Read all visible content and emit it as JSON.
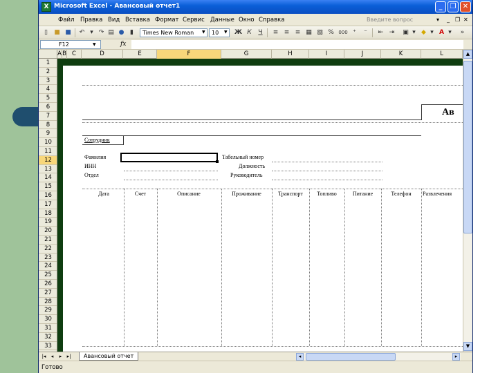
{
  "window": {
    "title": "Microsoft Excel - Авансовый отчет1",
    "icon_label": "X",
    "minimize": "_",
    "restore": "❐",
    "close": "✕"
  },
  "menu": {
    "items": [
      "Файл",
      "Правка",
      "Вид",
      "Вставка",
      "Формат",
      "Сервис",
      "Данные",
      "Окно",
      "Справка"
    ],
    "help_placeholder": "Введите вопрос",
    "doc_minimize": "_",
    "doc_restore": "❐",
    "doc_close": "✕"
  },
  "toolbar": {
    "font_name": "Times New Roman",
    "font_size": "10",
    "bold": "Ж",
    "italic": "К",
    "underline": "Ч",
    "percent": "%",
    "thousands": "000"
  },
  "formula_bar": {
    "name_box": "F12",
    "fx": "fx"
  },
  "columns": [
    "A",
    "B",
    "C",
    "D",
    "E",
    "F",
    "G",
    "H",
    "I",
    "J",
    "K",
    "L"
  ],
  "rows": [
    "1",
    "2",
    "3",
    "4",
    "5",
    "6",
    "7",
    "8",
    "9",
    "10",
    "11",
    "12",
    "13",
    "14",
    "15",
    "16",
    "17",
    "18",
    "19",
    "20",
    "21",
    "22",
    "23",
    "24",
    "25",
    "26",
    "27",
    "28",
    "29",
    "30",
    "31",
    "32",
    "33"
  ],
  "sheet": {
    "title": "Ав",
    "employee_label": "Сотрудник",
    "surname_label": "Фамилия",
    "inn_label": "ИНН",
    "department_label": "Отдел",
    "tab_number_label": "Табельный номер",
    "position_label": "Должность",
    "manager_label": "Руководитель",
    "table_headers": [
      "Дата",
      "Счет",
      "Описание",
      "Проживание",
      "Транспорт",
      "Топливо",
      "Питание",
      "Телефон",
      "Развлечения"
    ]
  },
  "tabs": {
    "active": "Авансовый отчет"
  },
  "status": {
    "text": "Готово"
  },
  "colors": {
    "titlebar": "#0a5fd8",
    "sheet_border": "#0f3d10",
    "side_panel": "#9fc39a",
    "side_blob": "#1f4e6e"
  }
}
